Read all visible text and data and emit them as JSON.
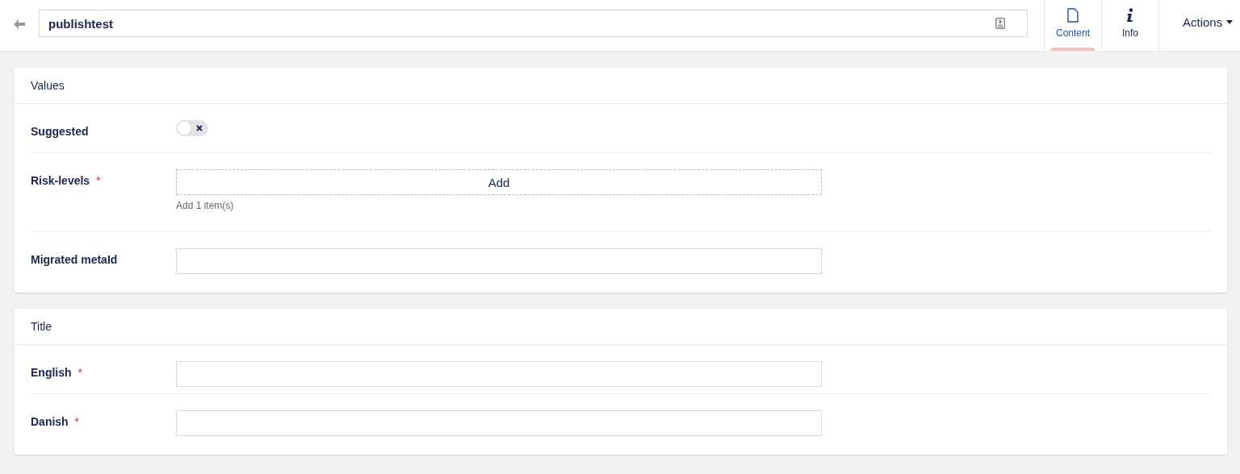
{
  "header": {
    "name_value": "publishtest",
    "tabs": [
      {
        "label": "Content",
        "kind": "document",
        "selected": true
      },
      {
        "label": "Info",
        "kind": "info",
        "selected": false
      }
    ],
    "actions_label": "Actions"
  },
  "groups": [
    {
      "title": "Values",
      "fields": [
        {
          "kind": "toggle",
          "label": "Suggested",
          "on": false
        },
        {
          "kind": "repeater",
          "label": "Risk-levels",
          "required_mark": "*",
          "button_label": "Add",
          "hint": "Add 1 item(s)"
        },
        {
          "kind": "text",
          "label": "Migrated metaId"
        }
      ]
    },
    {
      "title": "Title",
      "fields": [
        {
          "kind": "text",
          "label": "English",
          "required_mark": "*"
        },
        {
          "kind": "text",
          "label": "Danish",
          "required_mark": "*"
        }
      ]
    }
  ]
}
